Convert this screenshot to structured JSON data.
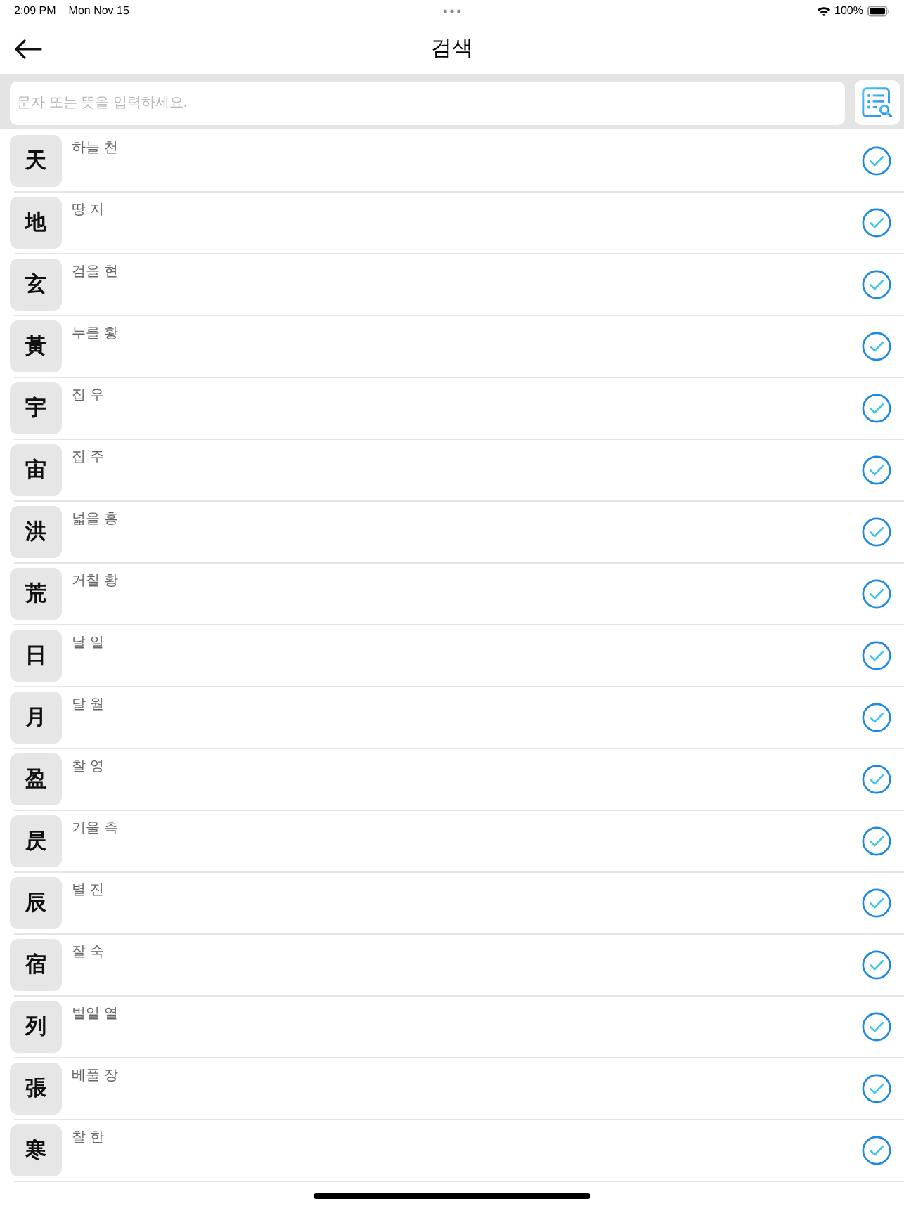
{
  "status_bar": {
    "time": "2:09 PM",
    "date": "Mon Nov 15",
    "battery": "100%"
  },
  "nav": {
    "title": "검색"
  },
  "search": {
    "placeholder": "문자 또는 뜻을 입력하세요."
  },
  "rows": [
    {
      "character": "天",
      "meaning": "하늘 천",
      "checked": true
    },
    {
      "character": "地",
      "meaning": "땅 지",
      "checked": true
    },
    {
      "character": "玄",
      "meaning": "검을 현",
      "checked": true
    },
    {
      "character": "黃",
      "meaning": "누를 황",
      "checked": true
    },
    {
      "character": "宇",
      "meaning": "집 우",
      "checked": true
    },
    {
      "character": "宙",
      "meaning": "집 주",
      "checked": true
    },
    {
      "character": "洪",
      "meaning": "넓을 홍",
      "checked": true
    },
    {
      "character": "荒",
      "meaning": "거칠 황",
      "checked": true
    },
    {
      "character": "日",
      "meaning": "날 일",
      "checked": true
    },
    {
      "character": "月",
      "meaning": "달 월",
      "checked": true
    },
    {
      "character": "盈",
      "meaning": "찰 영",
      "checked": true
    },
    {
      "character": "昃",
      "meaning": "기울 측",
      "checked": true
    },
    {
      "character": "辰",
      "meaning": "별 진",
      "checked": true
    },
    {
      "character": "宿",
      "meaning": "잘 숙",
      "checked": true
    },
    {
      "character": "列",
      "meaning": "벌일 열",
      "checked": true
    },
    {
      "character": "張",
      "meaning": "베풀 장",
      "checked": true
    },
    {
      "character": "寒",
      "meaning": "찰 한",
      "checked": true
    }
  ]
}
